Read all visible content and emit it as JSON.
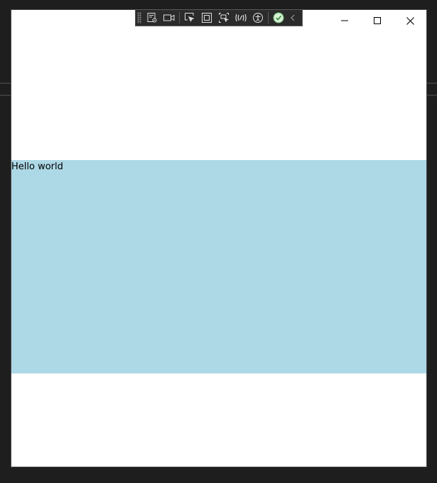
{
  "window": {
    "background": "#ffffff",
    "caption_buttons": [
      {
        "name": "minimize-button",
        "icon": "minimize-icon"
      },
      {
        "name": "maximize-button",
        "icon": "maximize-icon"
      },
      {
        "name": "close-button",
        "icon": "close-icon"
      }
    ]
  },
  "debug_toolbar": {
    "background": "#2b2b2b",
    "tools": [
      "live-visual-tree-icon",
      "video-camera-icon",
      "select-element-icon",
      "display-layout-adorners-icon",
      "track-focus-icon",
      "hot-reload-icon",
      "accessibility-icon",
      "checkmark-icon",
      "collapse-chevron-icon"
    ]
  },
  "content": {
    "text": "Hello world",
    "background": "#add8e6"
  }
}
